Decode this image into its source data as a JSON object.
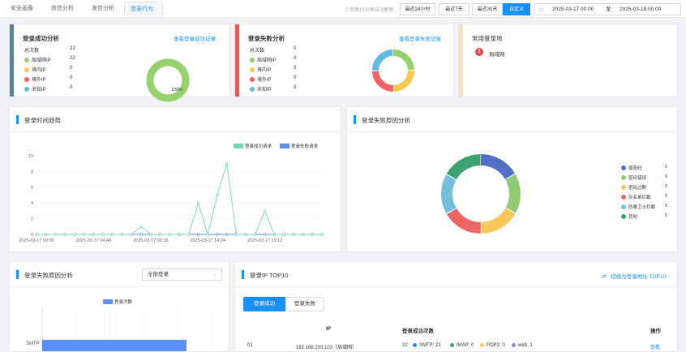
{
  "tabs": [
    "安全画像",
    "收信分析",
    "发信分析",
    "登录行为"
  ],
  "refresh_hint": "①页面15分钟自动刷新",
  "range_buttons": [
    "最近24小时",
    "最近7天",
    "最近30天",
    "自定义"
  ],
  "date_range": {
    "start": "2025-03-17 00:00",
    "sep": "至",
    "end": "2025-03-18 00:00"
  },
  "colors": {
    "accent": "#1890ff",
    "green": "#95d26d",
    "yellow": "#f9c851",
    "red": "#ec6464",
    "cyan": "#62b9e3",
    "darkblue": "#5470c6",
    "darkgreen": "#3ba272",
    "teal": "#72d6b7"
  },
  "success_card": {
    "title": "登录成功分析",
    "link": "查看登录成功记录",
    "rows": [
      {
        "label": "总次数",
        "value": "22"
      },
      {
        "label": "局域网IP",
        "value": "22"
      },
      {
        "label": "境内IP",
        "value": "0"
      },
      {
        "label": "境外IP",
        "value": "0"
      },
      {
        "label": "未知IP",
        "value": "0"
      }
    ],
    "donut_label": "100%"
  },
  "fail_card": {
    "title": "登录失败分析",
    "link": "查看登录失败记录",
    "rows": [
      {
        "label": "总次数",
        "value": "0"
      },
      {
        "label": "局域网IP",
        "value": "0"
      },
      {
        "label": "境内IP",
        "value": "0"
      },
      {
        "label": "境外IP",
        "value": "0"
      },
      {
        "label": "未知IP",
        "value": "0"
      }
    ]
  },
  "common_card": {
    "title": "常用登录地",
    "badge": "1",
    "place": "局域网"
  },
  "trend": {
    "title": "登录时间趋势",
    "legend": [
      "登录成功请求",
      "登录失败请求"
    ]
  },
  "fail_reason": {
    "title": "登录失败原因分析",
    "items": [
      {
        "label": "弱密码",
        "value": "0",
        "color": "#5470c6"
      },
      {
        "label": "密码错误",
        "value": "0",
        "color": "#91cc75"
      },
      {
        "label": "密码过期",
        "value": "0",
        "color": "#fac858"
      },
      {
        "label": "灰名单拦截",
        "value": "0",
        "color": "#ee6666"
      },
      {
        "label": "防暴卫士拦截",
        "value": "0",
        "color": "#73c0de"
      },
      {
        "label": "其他",
        "value": "0",
        "color": "#3ba272"
      }
    ]
  },
  "fail_reason2": {
    "title": "登录失败原因分析",
    "select": "全部登录",
    "legend": "登录次数",
    "bar_label": "SMTP"
  },
  "top10": {
    "title": "登录IP TOP10",
    "switch": "切换为登录地址 TOP10",
    "tabs": [
      "登录成功",
      "登录失败"
    ],
    "headers": [
      "IP",
      "登录成功次数",
      "操作"
    ],
    "rows": [
      {
        "rank": "01",
        "ip": "192.168.203.103（局域网）",
        "count": "22",
        "smtp": "SMTP: 21",
        "imap": "IMAP: 0",
        "pop3": "POP3: 0",
        "web": "web: 1",
        "action": "查看"
      }
    ]
  },
  "chart_data": {
    "type": "line",
    "x": [
      "2025-03-17 00:00",
      "2025-03-17 00:48",
      "2025-03-17 01:36",
      "2025-03-17 02:24",
      "2025-03-17 03:12",
      "2025-03-17 04:00",
      "2025-03-17 04:48",
      "2025-03-17 05:36",
      "2025-03-17 06:24",
      "2025-03-17 07:12",
      "2025-03-17 08:00",
      "2025-03-17 08:48",
      "2025-03-17 09:36",
      "2025-03-17 10:24",
      "2025-03-17 11:12",
      "2025-03-17 12:00",
      "2025-03-17 12:48",
      "2025-03-17 13:36",
      "2025-03-17 14:24",
      "2025-03-17 15:12",
      "2025-03-17 16:00",
      "2025-03-17 16:48",
      "2025-03-17 17:36",
      "2025-03-17 18:24",
      "2025-03-17 19:12",
      "2025-03-17 20:00",
      "2025-03-17 20:48",
      "2025-03-17 21:36",
      "2025-03-17 22:24",
      "2025-03-17 23:12"
    ],
    "tick_labels": [
      "2025-03-17 00:00",
      "2025-03-17 04:48",
      "2025-03-17 09:36",
      "2025-03-17 14:24",
      "2025-03-17 19:12"
    ],
    "ylim": [
      0,
      10
    ],
    "y_ticks": [
      "0",
      "2",
      "4",
      "6",
      "8",
      "10"
    ],
    "series": [
      {
        "name": "登录成功请求",
        "color": "#72d6b7",
        "values": [
          0,
          0,
          0,
          0,
          0,
          0,
          0,
          0,
          0,
          0,
          0,
          1,
          0,
          0,
          0,
          0,
          0,
          4,
          0,
          5,
          9,
          0,
          0,
          0,
          3,
          0,
          0,
          0,
          0,
          0,
          0
        ]
      },
      {
        "name": "登录失败请求",
        "color": "#5b8ff9",
        "values": [
          0,
          0,
          0,
          0,
          0,
          0,
          0,
          0,
          0,
          0,
          0,
          0,
          0,
          0,
          0,
          0,
          0,
          0,
          0,
          0,
          0,
          0,
          0,
          0,
          0,
          0,
          0,
          0,
          0,
          0,
          0
        ]
      }
    ]
  }
}
